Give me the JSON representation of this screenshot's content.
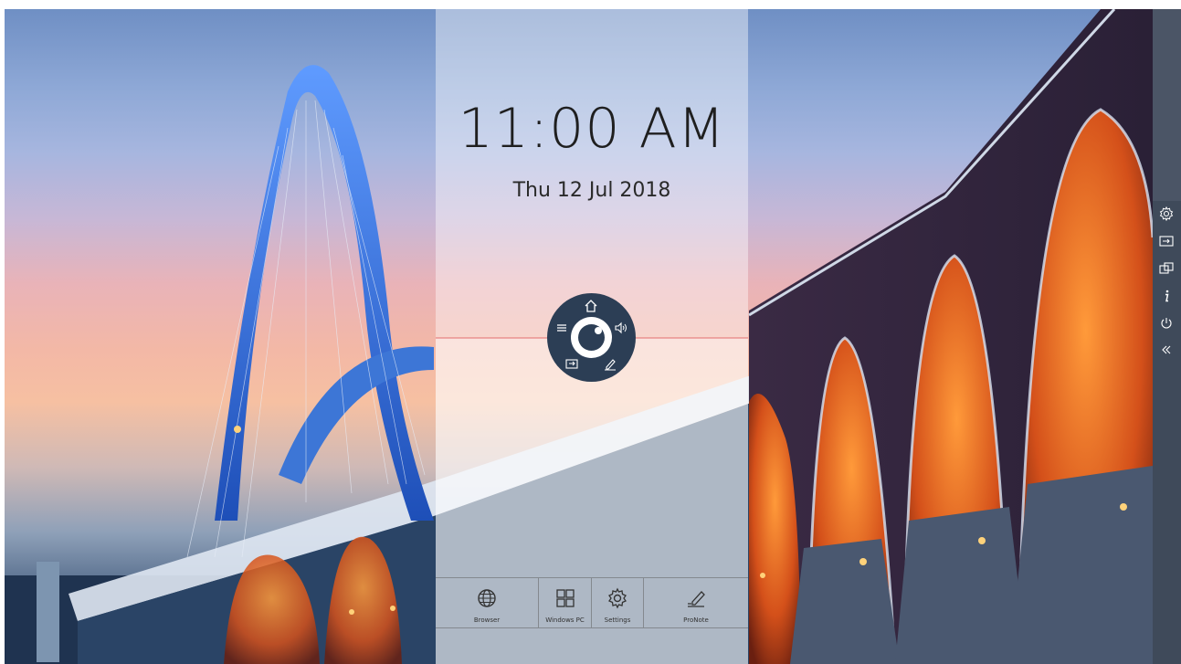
{
  "lockscreen": {
    "time": "11:00 AM",
    "date": "Thu 12 Jul 2018"
  },
  "radial_menu": {
    "items": [
      {
        "icon": "home-icon"
      },
      {
        "icon": "menu-icon"
      },
      {
        "icon": "volume-icon"
      },
      {
        "icon": "input-source-icon"
      },
      {
        "icon": "pen-icon"
      }
    ],
    "center_icon": "launcher-ring-icon"
  },
  "dock": {
    "items": [
      {
        "label": "Browser",
        "icon": "globe-icon"
      },
      {
        "label": "Windows PC",
        "icon": "windows-icon"
      },
      {
        "label": "Settings",
        "icon": "gear-icon"
      },
      {
        "label": "ProNote",
        "icon": "note-pen-icon"
      }
    ]
  },
  "sidebar": {
    "items": [
      {
        "icon": "gear-icon"
      },
      {
        "icon": "input-icon"
      },
      {
        "icon": "screen-share-icon"
      },
      {
        "icon": "info-icon"
      },
      {
        "icon": "power-icon"
      },
      {
        "icon": "collapse-icon"
      }
    ]
  },
  "colors": {
    "radial_bg": "#2c3e55",
    "sidebar_bg": "#3f4a5a",
    "bridge_arch": "#2f6fe0",
    "arch_glow": "#e2581c"
  }
}
